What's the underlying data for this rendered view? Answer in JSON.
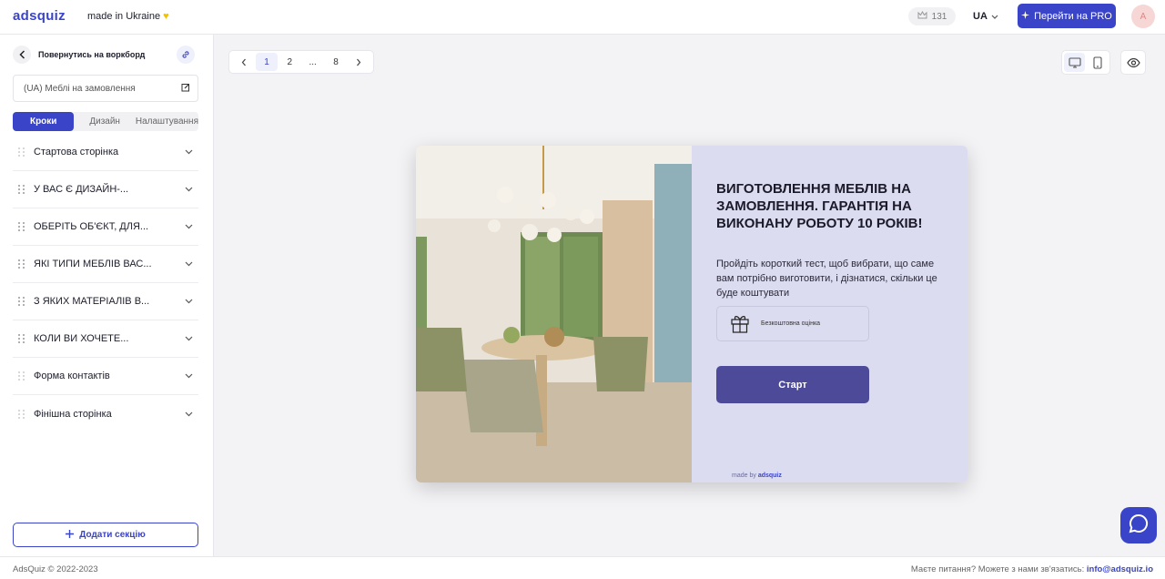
{
  "topbar": {
    "logo": "adsquiz",
    "tagline": "made in Ukraine",
    "coins": "131",
    "language": "UA",
    "pro_button": "Перейти на PRO",
    "avatar_initial": "A"
  },
  "sidebar": {
    "back_label": "Повернутись на воркборд",
    "project_name": "(UA) Меблі на замовлення",
    "tabs": [
      "Кроки",
      "Дизайн",
      "Налаштування"
    ],
    "steps": [
      "Стартова сторінка",
      "У ВАС Є ДИЗАЙН-...",
      "ОБЕРІТЬ ОБ'ЄКТ, ДЛЯ...",
      "ЯКІ ТИПИ МЕБЛІВ ВАС...",
      "З ЯКИХ МАТЕРІАЛІВ В...",
      "КОЛИ ВИ ХОЧЕТЕ...",
      "Форма контактів",
      "Фінішна сторінка"
    ],
    "add_section": "Додати секцію"
  },
  "pager": {
    "pages": [
      "1",
      "2",
      "...",
      "8"
    ],
    "current": "1"
  },
  "preview": {
    "title": "ВИГОТОВЛЕННЯ МЕБЛІВ НА ЗАМОВЛЕННЯ. ГАРАНТІЯ НА ВИКОНАНУ РОБОТУ 10 РОКІВ!",
    "subtitle": "Пройдіть короткий тест, щоб вибрати, що саме вам потрібно виготовити, і дізнатися, скільки це буде коштувати",
    "perk": "Безкоштовна оцінка",
    "start_button": "Старт",
    "madeby_prefix": "made by",
    "madeby_brand": "adsquiz"
  },
  "footer": {
    "copyright": "AdsQuiz © 2022-2023",
    "contact_text": "Маєте питання? Можете з нами зв'язатись:",
    "contact_email": "info@adsquiz.io"
  },
  "colors": {
    "accent": "#3a44c8",
    "start_button": "#4d4a9a",
    "panel_bg": "#dcdcf0"
  }
}
